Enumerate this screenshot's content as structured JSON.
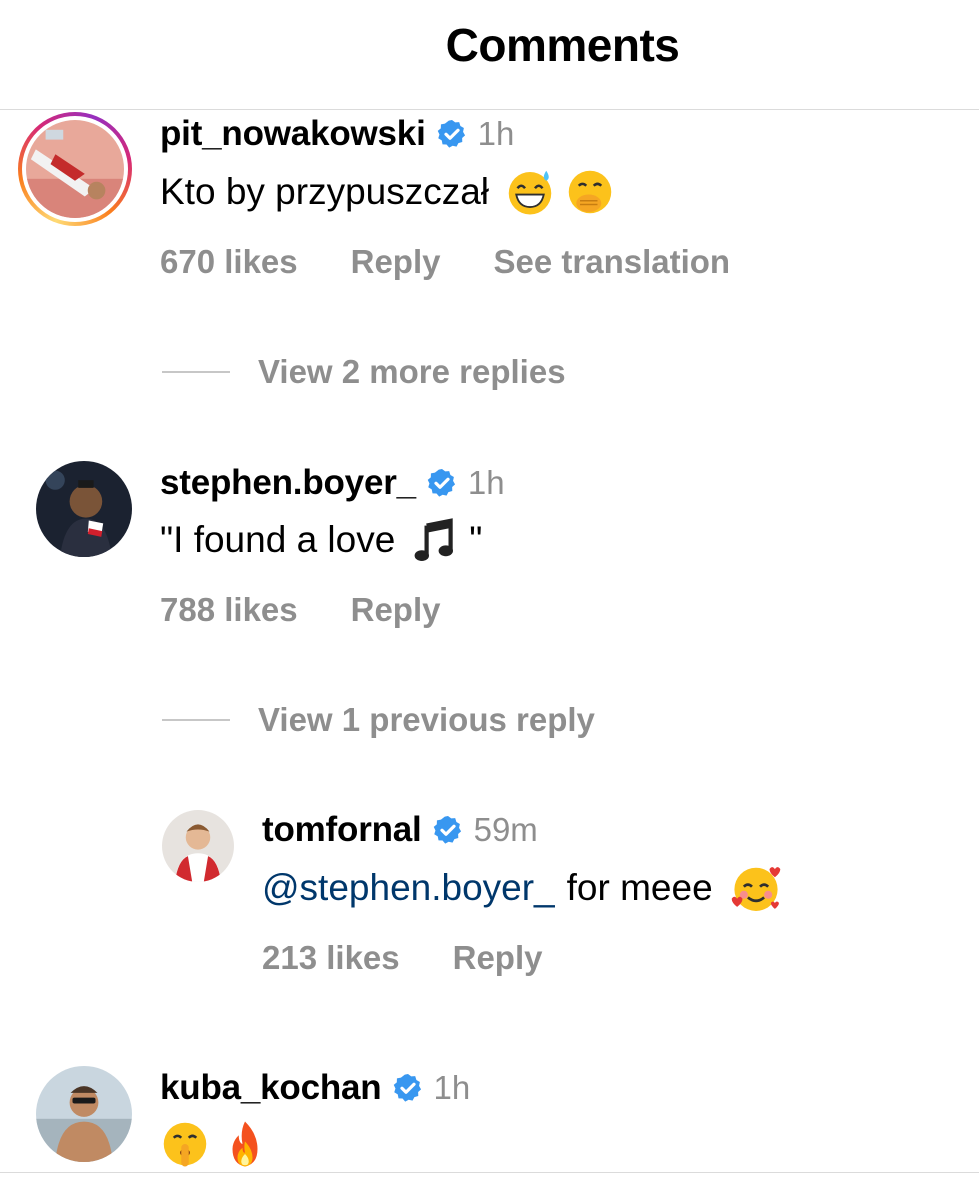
{
  "header": {
    "title": "Comments"
  },
  "comments": [
    {
      "username": "pit_nowakowski",
      "time": "1h",
      "text": "Kto by przypuszczał",
      "emojis": [
        "sweat-smile-emoji",
        "hand-over-mouth-emoji"
      ],
      "likes": "670 likes",
      "reply": "Reply",
      "translate": "See translation",
      "view_replies": "View 2 more replies"
    },
    {
      "username": "stephen.boyer_",
      "time": "1h",
      "text_before": "\"I found a love",
      "text_after": "\"",
      "emojis": [
        "music-notes-emoji"
      ],
      "likes": "788 likes",
      "reply": "Reply",
      "view_replies": "View 1 previous reply"
    },
    {
      "username": "tomfornal",
      "time": "59m",
      "mention": "@stephen.boyer_",
      "text": "for meee",
      "emojis": [
        "smiling-face-with-hearts-emoji"
      ],
      "likes": "213 likes",
      "reply": "Reply"
    },
    {
      "username": "kuba_kochan",
      "time": "1h",
      "emojis": [
        "shushing-face-emoji",
        "fire-emoji"
      ]
    }
  ],
  "colors": {
    "verified": "#3897f0",
    "secondary_text": "#8e8e8e",
    "mention": "#00376b",
    "divider": "#dbdbdb"
  }
}
